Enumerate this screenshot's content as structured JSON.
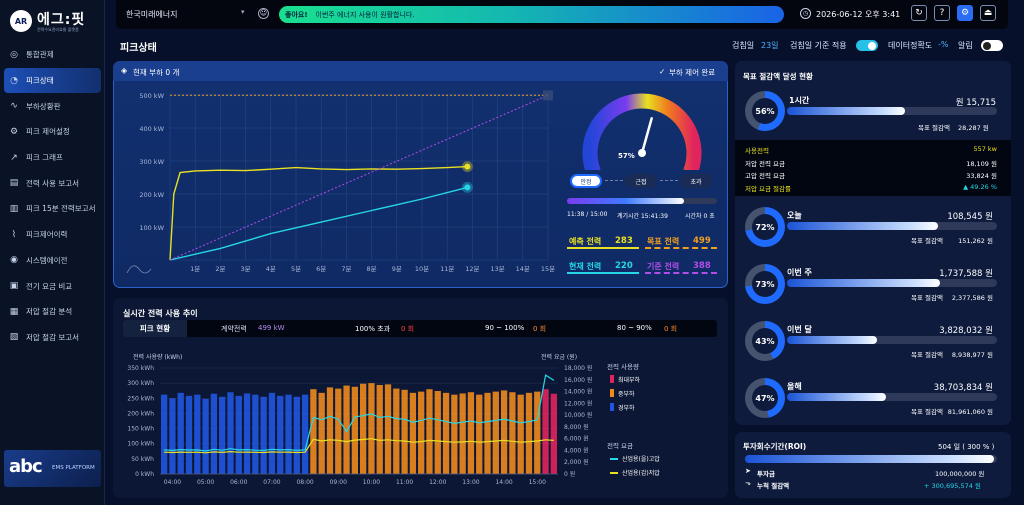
{
  "app": {
    "logo_badge": "AR",
    "logo_title": "에그:핏",
    "logo_sub": "전력수요관리효율 플랫폼",
    "ems_abc": "abc",
    "ems_label": "EMS PLATFORM"
  },
  "nav": [
    {
      "label": "통합관제",
      "icon": "globe-icon",
      "glyph": "◎"
    },
    {
      "label": "피크상태",
      "icon": "gauge-icon",
      "glyph": "◔",
      "active": true
    },
    {
      "label": "부하상황판",
      "icon": "pulse-icon",
      "glyph": "∿"
    },
    {
      "label": "피크 제어설정",
      "icon": "gear-icon",
      "glyph": "⚙"
    },
    {
      "label": "피크 그래프",
      "icon": "line-chart-icon",
      "glyph": "↗"
    },
    {
      "label": "전력 사용 보고서",
      "icon": "bar-report-icon",
      "glyph": "▤"
    },
    {
      "label": "피크 15분 전력보고서",
      "icon": "bar-chart-icon",
      "glyph": "▥"
    },
    {
      "label": "피크제어이력",
      "icon": "history-icon",
      "glyph": "⌇"
    },
    {
      "label": "시스템에이전",
      "icon": "agent-icon",
      "glyph": "◉"
    },
    {
      "label": "전기 요금 비교",
      "icon": "bill-icon",
      "glyph": "▣"
    },
    {
      "label": "저압 절감 분석",
      "icon": "analysis-icon",
      "glyph": "▦"
    },
    {
      "label": "저압 절감 보고서",
      "icon": "document-icon",
      "glyph": "▧"
    }
  ],
  "topbar": {
    "company": "한국미래에너지",
    "alert_tag": "좋아요!",
    "alert_text": "이번주 에너지 사용이 원활합니다.",
    "datetime": "2026-06-12  오후 3:41"
  },
  "page": {
    "title": "피크상태",
    "check_day_label": "검침일",
    "check_day_value": "23일",
    "check_basis_label": "검침일 기준 적용",
    "accuracy_label": "데이터정확도",
    "accuracy_value": "-%",
    "alarm_label": "알림"
  },
  "peak_panel": {
    "header_left": "현재 부하 0 개",
    "header_right": "부하 제어 완료",
    "gauge_value": "57%",
    "gauge_fraction": 0.57,
    "chips": [
      "안정",
      "근접",
      "초과"
    ],
    "progress_left": "11:38 / 15:00",
    "progress_mid": "계기시간 15:41:39",
    "progress_right": "시간차 0 초",
    "progress_fraction": 0.78,
    "predicted_label": "예측 전력",
    "predicted_value": "283",
    "target_label": "목표 전력",
    "target_value": "499",
    "current_label": "현재 전력",
    "current_value": "220",
    "base_label": "기준 전력",
    "base_value": "388"
  },
  "realtime": {
    "title": "실시간 전력 사용 추이",
    "peak_label": "피크 현황",
    "contract_label": "계약전력",
    "contract_value": "499 kW",
    "over_label": "100% 초과",
    "over_value": "0 회",
    "band1_label": "90 ~ 100%",
    "band1_value": "0 회",
    "band2_label": "80 ~ 90%",
    "band2_value": "0 회",
    "left_axis_title": "전력 사용량 (kWh)",
    "right_axis_title": "전력 요금 (원)",
    "legend_usage_title": "전력 사용량",
    "legend_usage": [
      {
        "label": "최대부하",
        "color": "#e0245e"
      },
      {
        "label": "중부하",
        "color": "#f08a1c"
      },
      {
        "label": "경부하",
        "color": "#1f55e0"
      }
    ],
    "legend_fee_title": "전력 요금",
    "legend_fee": [
      {
        "label": "산업용(을)고압",
        "color": "#27d6e6"
      },
      {
        "label": "산업용(갑)저압",
        "color": "#e8e020"
      }
    ]
  },
  "savings": {
    "title": "목표 절감액 달성 현황",
    "hour": {
      "label": "1시간",
      "value": "15,715 원",
      "percent": "56%",
      "fraction": 0.56,
      "target_label": "목표 절감액",
      "target_value": "28,287 원"
    },
    "detail": [
      {
        "label": "사용전력",
        "value": "557 kw"
      },
      {
        "label": "저압 전력 요금",
        "value": "18,109 원"
      },
      {
        "label": "고압 전력 요금",
        "value": "33,824 원"
      },
      {
        "label": "저압 요금 절감률",
        "value": "▲ 49.26 %"
      }
    ],
    "periods": [
      {
        "label": "오늘",
        "value": "108,545 원",
        "percent": "72%",
        "fraction": 0.72,
        "target_label": "목표 절감액",
        "target_value": "151,262 원"
      },
      {
        "label": "이번 주",
        "value": "1,737,588 원",
        "percent": "73%",
        "fraction": 0.73,
        "target_label": "목표 절감액",
        "target_value": "2,377,586 원"
      },
      {
        "label": "이번 달",
        "value": "3,828,032 원",
        "percent": "43%",
        "fraction": 0.43,
        "target_label": "목표 절감액",
        "target_value": "8,938,977 원"
      },
      {
        "label": "올해",
        "value": "38,703,834 원",
        "percent": "47%",
        "fraction": 0.47,
        "target_label": "목표 절감액",
        "target_value": "81,961,060 원"
      }
    ]
  },
  "roi": {
    "title": "투자회수기간(ROI)",
    "summary": "504 일 ( 300 % )",
    "fraction": 0.99,
    "invest_label": "투자금",
    "invest_value": "100,000,000 원",
    "cum_label": "누적 절감액",
    "cum_value": "+ 300,695,574 원"
  },
  "chart_data": [
    {
      "type": "line",
      "title": "",
      "x_ticks": [
        "1분",
        "2분",
        "3분",
        "4분",
        "5분",
        "6분",
        "7분",
        "8분",
        "9분",
        "10분",
        "11분",
        "12분",
        "13분",
        "14분",
        "15분"
      ],
      "y_ticks": [
        "100 kW",
        "200 kW",
        "300 kW",
        "400 kW",
        "500 kW"
      ],
      "xlim": [
        0,
        15
      ],
      "ylim": [
        0,
        500
      ],
      "series": [
        {
          "values": [
            [
              0,
              0
            ],
            [
              0.15,
              200
            ],
            [
              0.4,
              265
            ],
            [
              1,
              270
            ],
            [
              2,
              272
            ],
            [
              3,
              271
            ],
            [
              4,
              275
            ],
            [
              5,
              280
            ],
            [
              6,
              276
            ],
            [
              7,
              274
            ],
            [
              8,
              276
            ],
            [
              9,
              275
            ],
            [
              10,
              277
            ],
            [
              11,
              280
            ],
            [
              11.8,
              283
            ]
          ]
        },
        {
          "values": [
            [
              0,
              0
            ],
            [
              2,
              35
            ],
            [
              4,
              80
            ],
            [
              6,
              115
            ],
            [
              8,
              150
            ],
            [
              10,
              185
            ],
            [
              11.8,
              220
            ]
          ]
        },
        {
          "values": [
            [
              0,
              0
            ],
            [
              15,
              499
            ]
          ],
          "dash": true
        },
        {
          "values": [
            [
              0,
              499
            ],
            [
              15,
              499
            ]
          ],
          "dash": true
        }
      ]
    },
    {
      "type": "bar",
      "title": "",
      "categories": [
        "03:45",
        "04:00",
        "04:15",
        "04:30",
        "04:45",
        "05:00",
        "05:15",
        "05:30",
        "05:45",
        "06:00",
        "06:15",
        "06:30",
        "06:45",
        "07:00",
        "07:15",
        "07:30",
        "07:45",
        "08:00",
        "08:15",
        "08:30",
        "08:45",
        "09:00",
        "09:15",
        "09:30",
        "09:45",
        "10:00",
        "10:15",
        "10:30",
        "10:45",
        "11:00",
        "11:15",
        "11:30",
        "11:45",
        "12:00",
        "12:15",
        "12:30",
        "12:45",
        "13:00",
        "13:15",
        "13:30",
        "13:45",
        "14:00",
        "14:15",
        "14:30",
        "14:45",
        "15:00",
        "15:15",
        "15:30"
      ],
      "x_ticks": [
        "04:00",
        "05:00",
        "06:00",
        "07:00",
        "08:00",
        "09:00",
        "10:00",
        "11:00",
        "12:00",
        "13:00",
        "14:00",
        "15:00"
      ],
      "y_ticks": [
        "0 kWh",
        "50 kWh",
        "100 kWh",
        "150 kWh",
        "200 kWh",
        "250 kWh",
        "300 kWh",
        "350 kWh"
      ],
      "ylim": [
        0,
        350
      ],
      "y2_ticks": [
        "0 원",
        "2,000 원",
        "4,000 원",
        "6,000 원",
        "8,000 원",
        "10,000 원",
        "12,000 원",
        "14,000 원",
        "16,000 원",
        "18,000 원"
      ],
      "y2lim": [
        0,
        18000
      ],
      "series": [
        {
          "name": "최대부하",
          "values": [
            0,
            0,
            0,
            0,
            0,
            0,
            0,
            0,
            0,
            0,
            0,
            0,
            0,
            0,
            0,
            0,
            0,
            0,
            0,
            0,
            0,
            0,
            0,
            0,
            0,
            0,
            0,
            0,
            0,
            0,
            0,
            0,
            0,
            0,
            0,
            0,
            0,
            0,
            0,
            0,
            0,
            0,
            0,
            0,
            0,
            0,
            280,
            265
          ]
        },
        {
          "name": "중부하",
          "values": [
            0,
            0,
            0,
            0,
            0,
            0,
            0,
            0,
            0,
            0,
            0,
            0,
            0,
            0,
            0,
            0,
            0,
            0,
            280,
            268,
            286,
            282,
            292,
            288,
            298,
            300,
            294,
            296,
            282,
            278,
            268,
            272,
            280,
            274,
            268,
            262,
            266,
            270,
            262,
            268,
            272,
            276,
            270,
            262,
            268,
            272,
            0,
            0
          ]
        },
        {
          "name": "경부하",
          "values": [
            262,
            250,
            268,
            258,
            262,
            248,
            265,
            255,
            270,
            258,
            266,
            262,
            255,
            268,
            258,
            262,
            255,
            262,
            0,
            0,
            0,
            0,
            0,
            0,
            0,
            0,
            0,
            0,
            0,
            0,
            0,
            0,
            0,
            0,
            0,
            0,
            0,
            0,
            0,
            0,
            0,
            0,
            0,
            0,
            0,
            0,
            0,
            0
          ]
        },
        {
          "name": "산업용(을)고압",
          "axis": "right",
          "values": [
            4100,
            4000,
            4150,
            4080,
            4100,
            3900,
            4200,
            4050,
            4300,
            4100,
            4150,
            4050,
            4000,
            4200,
            4100,
            4150,
            4000,
            4100,
            9600,
            9200,
            9800,
            9300,
            7200,
            9700,
            9900,
            10200,
            9600,
            9800,
            9400,
            9300,
            8800,
            9100,
            9500,
            9200,
            8900,
            8600,
            8800,
            9000,
            8700,
            8900,
            9100,
            9300,
            9000,
            8700,
            8900,
            9200,
            16800,
            15900
          ]
        },
        {
          "name": "산업용(갑)저압",
          "axis": "right",
          "values": [
            3700,
            3650,
            3720,
            3680,
            3700,
            3600,
            3750,
            3660,
            3800,
            3700,
            3720,
            3690,
            3650,
            3760,
            3700,
            3720,
            3650,
            3700,
            5900,
            5600,
            5800,
            5700,
            5500,
            5750,
            5850,
            6000,
            5700,
            5800,
            5650,
            5600,
            5400,
            5500,
            5700,
            5600,
            5500,
            5400,
            5450,
            5550,
            5400,
            5500,
            5600,
            5700,
            5550,
            5400,
            5500,
            5600,
            5800,
            5700
          ]
        }
      ]
    }
  ],
  "colors": {
    "accent": "#1f6bff",
    "yellow": "#e8e020",
    "cyan": "#27d6e6",
    "purple": "#b14ee8",
    "orange": "#f0a020"
  }
}
